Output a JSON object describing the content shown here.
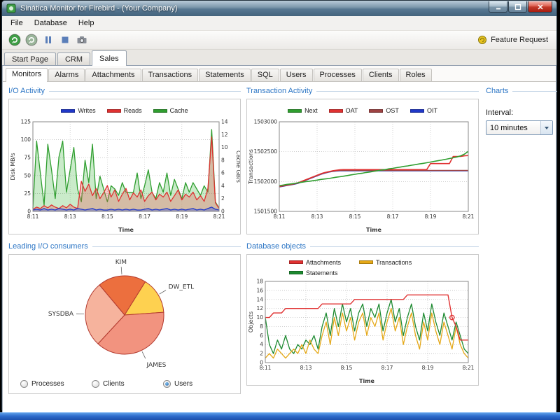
{
  "window": {
    "title": "Sinática Monitor for Firebird - (Your Company)"
  },
  "menu": {
    "items": [
      "File",
      "Database",
      "Help"
    ]
  },
  "toolbar": {
    "feature_request": "Feature Request",
    "buttons": [
      {
        "name": "refresh-button",
        "icon": "circle-arrow",
        "color": "#3f9e46"
      },
      {
        "name": "start-button",
        "icon": "circle-arrow",
        "color": "#9ab59a"
      },
      {
        "name": "pause-button",
        "icon": "pause",
        "color": "#5b7fb9"
      },
      {
        "name": "stop-button",
        "icon": "stop",
        "color": "#5b7fb9"
      },
      {
        "name": "snapshot-button",
        "icon": "camera",
        "color": "#8a8f98"
      }
    ]
  },
  "tabs_top": [
    {
      "label": "Start Page",
      "active": false
    },
    {
      "label": "CRM",
      "active": false
    },
    {
      "label": "Sales",
      "active": true
    }
  ],
  "tabs_inner": [
    {
      "label": "Monitors",
      "active": true
    },
    {
      "label": "Alarms",
      "active": false
    },
    {
      "label": "Attachments",
      "active": false
    },
    {
      "label": "Transactions",
      "active": false
    },
    {
      "label": "Statements",
      "active": false
    },
    {
      "label": "SQL",
      "active": false
    },
    {
      "label": "Users",
      "active": false
    },
    {
      "label": "Processes",
      "active": false
    },
    {
      "label": "Clients",
      "active": false
    },
    {
      "label": "Roles",
      "active": false
    }
  ],
  "sidebar": {
    "title": "Charts",
    "interval_label": "Interval:",
    "interval_value": "10 minutes"
  },
  "consumers": {
    "radios": [
      {
        "label": "Processes",
        "selected": false
      },
      {
        "label": "Clients",
        "selected": false
      },
      {
        "label": "Users",
        "selected": true
      }
    ]
  },
  "chart_data": [
    {
      "id": "chart-io",
      "type": "line",
      "title": "I/O Activity",
      "xlabel": "Time",
      "ylabel": "Disk MB/s",
      "y2label": "Cache GB/s",
      "ylim": [
        0,
        125
      ],
      "yticks": [
        "0",
        "25",
        "50",
        "75",
        "100",
        "125"
      ],
      "y2lim": [
        0,
        14
      ],
      "y2ticks": [
        "0",
        "2",
        "4",
        "6",
        "8",
        "10",
        "12",
        "14"
      ],
      "xticks": [
        "8:11",
        "8:13",
        "8:15",
        "8:17",
        "8:19",
        "8:21"
      ],
      "grid": true,
      "legend_position": "top",
      "series": [
        {
          "name": "Writes",
          "color": "#2038c8",
          "axis": "y1",
          "fill": "rgba(50,80,220,0.35)",
          "values": [
            2,
            3,
            2,
            4,
            2,
            3,
            2,
            4,
            3,
            2,
            3,
            2,
            4,
            3,
            2,
            3,
            4,
            2,
            3,
            2,
            2,
            3,
            2,
            3,
            2,
            3,
            2,
            3,
            2,
            2,
            3,
            4,
            2,
            3,
            2,
            3,
            4,
            2,
            3,
            2,
            3,
            2,
            3,
            4,
            2,
            3,
            2,
            4,
            6,
            3,
            2
          ]
        },
        {
          "name": "Reads",
          "color": "#e03131",
          "axis": "y1",
          "fill": "rgba(235,80,80,0.30)",
          "values": [
            3,
            6,
            4,
            8,
            5,
            9,
            6,
            4,
            8,
            5,
            10,
            6,
            4,
            42,
            28,
            38,
            22,
            32,
            18,
            26,
            36,
            20,
            30,
            14,
            24,
            32,
            16,
            26,
            20,
            30,
            14,
            22,
            27,
            16,
            24,
            20,
            27,
            14,
            22,
            30,
            16,
            24,
            20,
            27,
            16,
            22,
            14,
            32,
            104,
            12,
            4
          ]
        },
        {
          "name": "Cache",
          "color": "#2f9e2f",
          "axis": "y2",
          "fill": "rgba(80,190,80,0.30)",
          "values": [
            0.5,
            11,
            6,
            1,
            10.5,
            6.5,
            2,
            8.5,
            11,
            3,
            6.5,
            10,
            3.5,
            1.5,
            8,
            4.5,
            10.5,
            2,
            5.5,
            3.5,
            1.5,
            4,
            3.5,
            2.5,
            4.5,
            3,
            3,
            3,
            6,
            2,
            4,
            6.5,
            3,
            2,
            4.5,
            3,
            6,
            2.5,
            5,
            3.5,
            2,
            4.5,
            3,
            4.5,
            3.5,
            2.5,
            4,
            3,
            12.8,
            1.5,
            0.5
          ]
        }
      ]
    },
    {
      "id": "chart-tx",
      "type": "line",
      "title": "Transaction Activity",
      "xlabel": "Time",
      "ylabel": "Transactions",
      "ylim": [
        1501500,
        1503000
      ],
      "yticks": [
        "1501500",
        "1502000",
        "1502500",
        "1503000"
      ],
      "xticks": [
        "8:11",
        "8:13",
        "8:15",
        "8:17",
        "8:19",
        "8:21"
      ],
      "grid": true,
      "legend_position": "top",
      "series": [
        {
          "name": "Next",
          "color": "#2f9e2f",
          "width": 1.6,
          "values": [
            1501930,
            1501941,
            1501952,
            1501959,
            1501968,
            1501980,
            1501989,
            1501998,
            1502005,
            1502014,
            1502024,
            1502035,
            1502043,
            1502050,
            1502061,
            1502072,
            1502080,
            1502090,
            1502100,
            1502112,
            1502121,
            1502132,
            1502140,
            1502152,
            1502160,
            1502172,
            1502181,
            1502192,
            1502200,
            1502212,
            1502221,
            1502232,
            1502242,
            1502253,
            1502262,
            1502273,
            1502283,
            1502294,
            1502304,
            1502315,
            1502326,
            1502338,
            1502349,
            1502360,
            1502372,
            1502385,
            1502398,
            1502412,
            1502430,
            1502460,
            1502505
          ]
        },
        {
          "name": "OAT",
          "color": "#e03131",
          "width": 1.6,
          "values": [
            1501920,
            1501930,
            1501942,
            1501952,
            1501965,
            1501980,
            1502005,
            1502030,
            1502055,
            1502080,
            1502105,
            1502130,
            1502150,
            1502165,
            1502178,
            1502188,
            1502196,
            1502200,
            1502200,
            1502200,
            1502200,
            1502200,
            1502200,
            1502200,
            1502200,
            1502200,
            1502200,
            1502200,
            1502200,
            1502200,
            1502200,
            1502200,
            1502200,
            1502200,
            1502200,
            1502200,
            1502200,
            1502200,
            1502200,
            1502200,
            1502300,
            1502300,
            1502300,
            1502300,
            1502300,
            1502300,
            1502420,
            1502420,
            1502420,
            1502430,
            1502435
          ]
        },
        {
          "name": "OST",
          "color": "#9e4343",
          "width": 1.6,
          "values": [
            1501915,
            1501925,
            1501938,
            1501948,
            1501960,
            1501975,
            1502000,
            1502025,
            1502050,
            1502075,
            1502100,
            1502125,
            1502145,
            1502160,
            1502172,
            1502180,
            1502185,
            1502185,
            1502185,
            1502185,
            1502185,
            1502185,
            1502185,
            1502185,
            1502185,
            1502185,
            1502185,
            1502185,
            1502185,
            1502185,
            1502185,
            1502185,
            1502185,
            1502185,
            1502185,
            1502185,
            1502185,
            1502185,
            1502185,
            1502185,
            1502185,
            1502185,
            1502185,
            1502185,
            1502185,
            1502185,
            1502185,
            1502185,
            1502185,
            1502185,
            1502185
          ]
        },
        {
          "name": "OIT",
          "color": "#2038c8",
          "width": 1.6,
          "values": [
            1501911,
            1501921,
            1501934,
            1501944,
            1501956,
            1501971,
            1501996,
            1502021,
            1502046,
            1502071,
            1502096,
            1502121,
            1502141,
            1502156,
            1502168,
            1502176,
            1502181,
            1502181,
            1502181,
            1502181,
            1502181,
            1502181,
            1502181,
            1502181,
            1502181,
            1502181,
            1502181,
            1502181,
            1502181,
            1502181,
            1502181,
            1502181,
            1502181,
            1502181,
            1502181,
            1502181,
            1502181,
            1502181,
            1502181,
            1502181,
            1502181,
            1502181,
            1502181,
            1502181,
            1502181,
            1502181,
            1502181,
            1502181,
            1502181,
            1502181,
            1502181
          ]
        }
      ]
    },
    {
      "id": "chart-db",
      "type": "line",
      "title": "Database objects",
      "xlabel": "Time",
      "ylabel": "Objects",
      "ylim": [
        0,
        18
      ],
      "yticks": [
        "0",
        "2",
        "4",
        "6",
        "8",
        "10",
        "12",
        "14",
        "16",
        "18"
      ],
      "xticks": [
        "8:11",
        "8:13",
        "8:15",
        "8:17",
        "8:19",
        "8:21"
      ],
      "grid": true,
      "legend_position": "top",
      "series": [
        {
          "name": "Attachments",
          "color": "#e03131",
          "width": 1.4,
          "marker_index": 46,
          "values": [
            10,
            10,
            11,
            11,
            11,
            12,
            12,
            12,
            12,
            12,
            12,
            12,
            12,
            12,
            13,
            13,
            13,
            13,
            13,
            13,
            13,
            13,
            14,
            14,
            14,
            14,
            14,
            14,
            14,
            14,
            14,
            14,
            14,
            14,
            14,
            15,
            15,
            15,
            15,
            15,
            15,
            15,
            15,
            15,
            15,
            15,
            10,
            8,
            5,
            5,
            5
          ]
        },
        {
          "name": "Transactions",
          "color": "#e5a817",
          "width": 1.3,
          "values": [
            1,
            2,
            1,
            3,
            2,
            1,
            2,
            3,
            2,
            4,
            2,
            5,
            3,
            2,
            6,
            9,
            4,
            10,
            6,
            11,
            7,
            10,
            5,
            9,
            11,
            6,
            10,
            8,
            11,
            5,
            9,
            12,
            7,
            10,
            4,
            8,
            11,
            6,
            3,
            9,
            5,
            11,
            7,
            4,
            9,
            6,
            3,
            8,
            4,
            2,
            1
          ]
        },
        {
          "name": "Statements",
          "color": "#1d8a30",
          "width": 1.3,
          "values": [
            10,
            4,
            2,
            5,
            3,
            6,
            3,
            2,
            4,
            3,
            5,
            4,
            6,
            3,
            8,
            11,
            6,
            12,
            8,
            13,
            9,
            12,
            7,
            11,
            13,
            8,
            12,
            10,
            13,
            7,
            11,
            14,
            9,
            12,
            6,
            10,
            13,
            8,
            5,
            11,
            7,
            13,
            9,
            6,
            11,
            8,
            5,
            9,
            6,
            3,
            2
          ]
        }
      ]
    },
    {
      "id": "chart-pie",
      "type": "pie",
      "title": "Leading I/O consumers",
      "start_angle": 130,
      "slices": [
        {
          "label": "KIM",
          "value": 20,
          "color": "#ec6f3e"
        },
        {
          "label": "DW_ETL",
          "value": 15,
          "color": "#fed150"
        },
        {
          "label": "JAMES",
          "value": 38,
          "color": "#f2937f"
        },
        {
          "label": "SYSDBA",
          "value": 27,
          "color": "#f6b39d"
        }
      ]
    }
  ]
}
